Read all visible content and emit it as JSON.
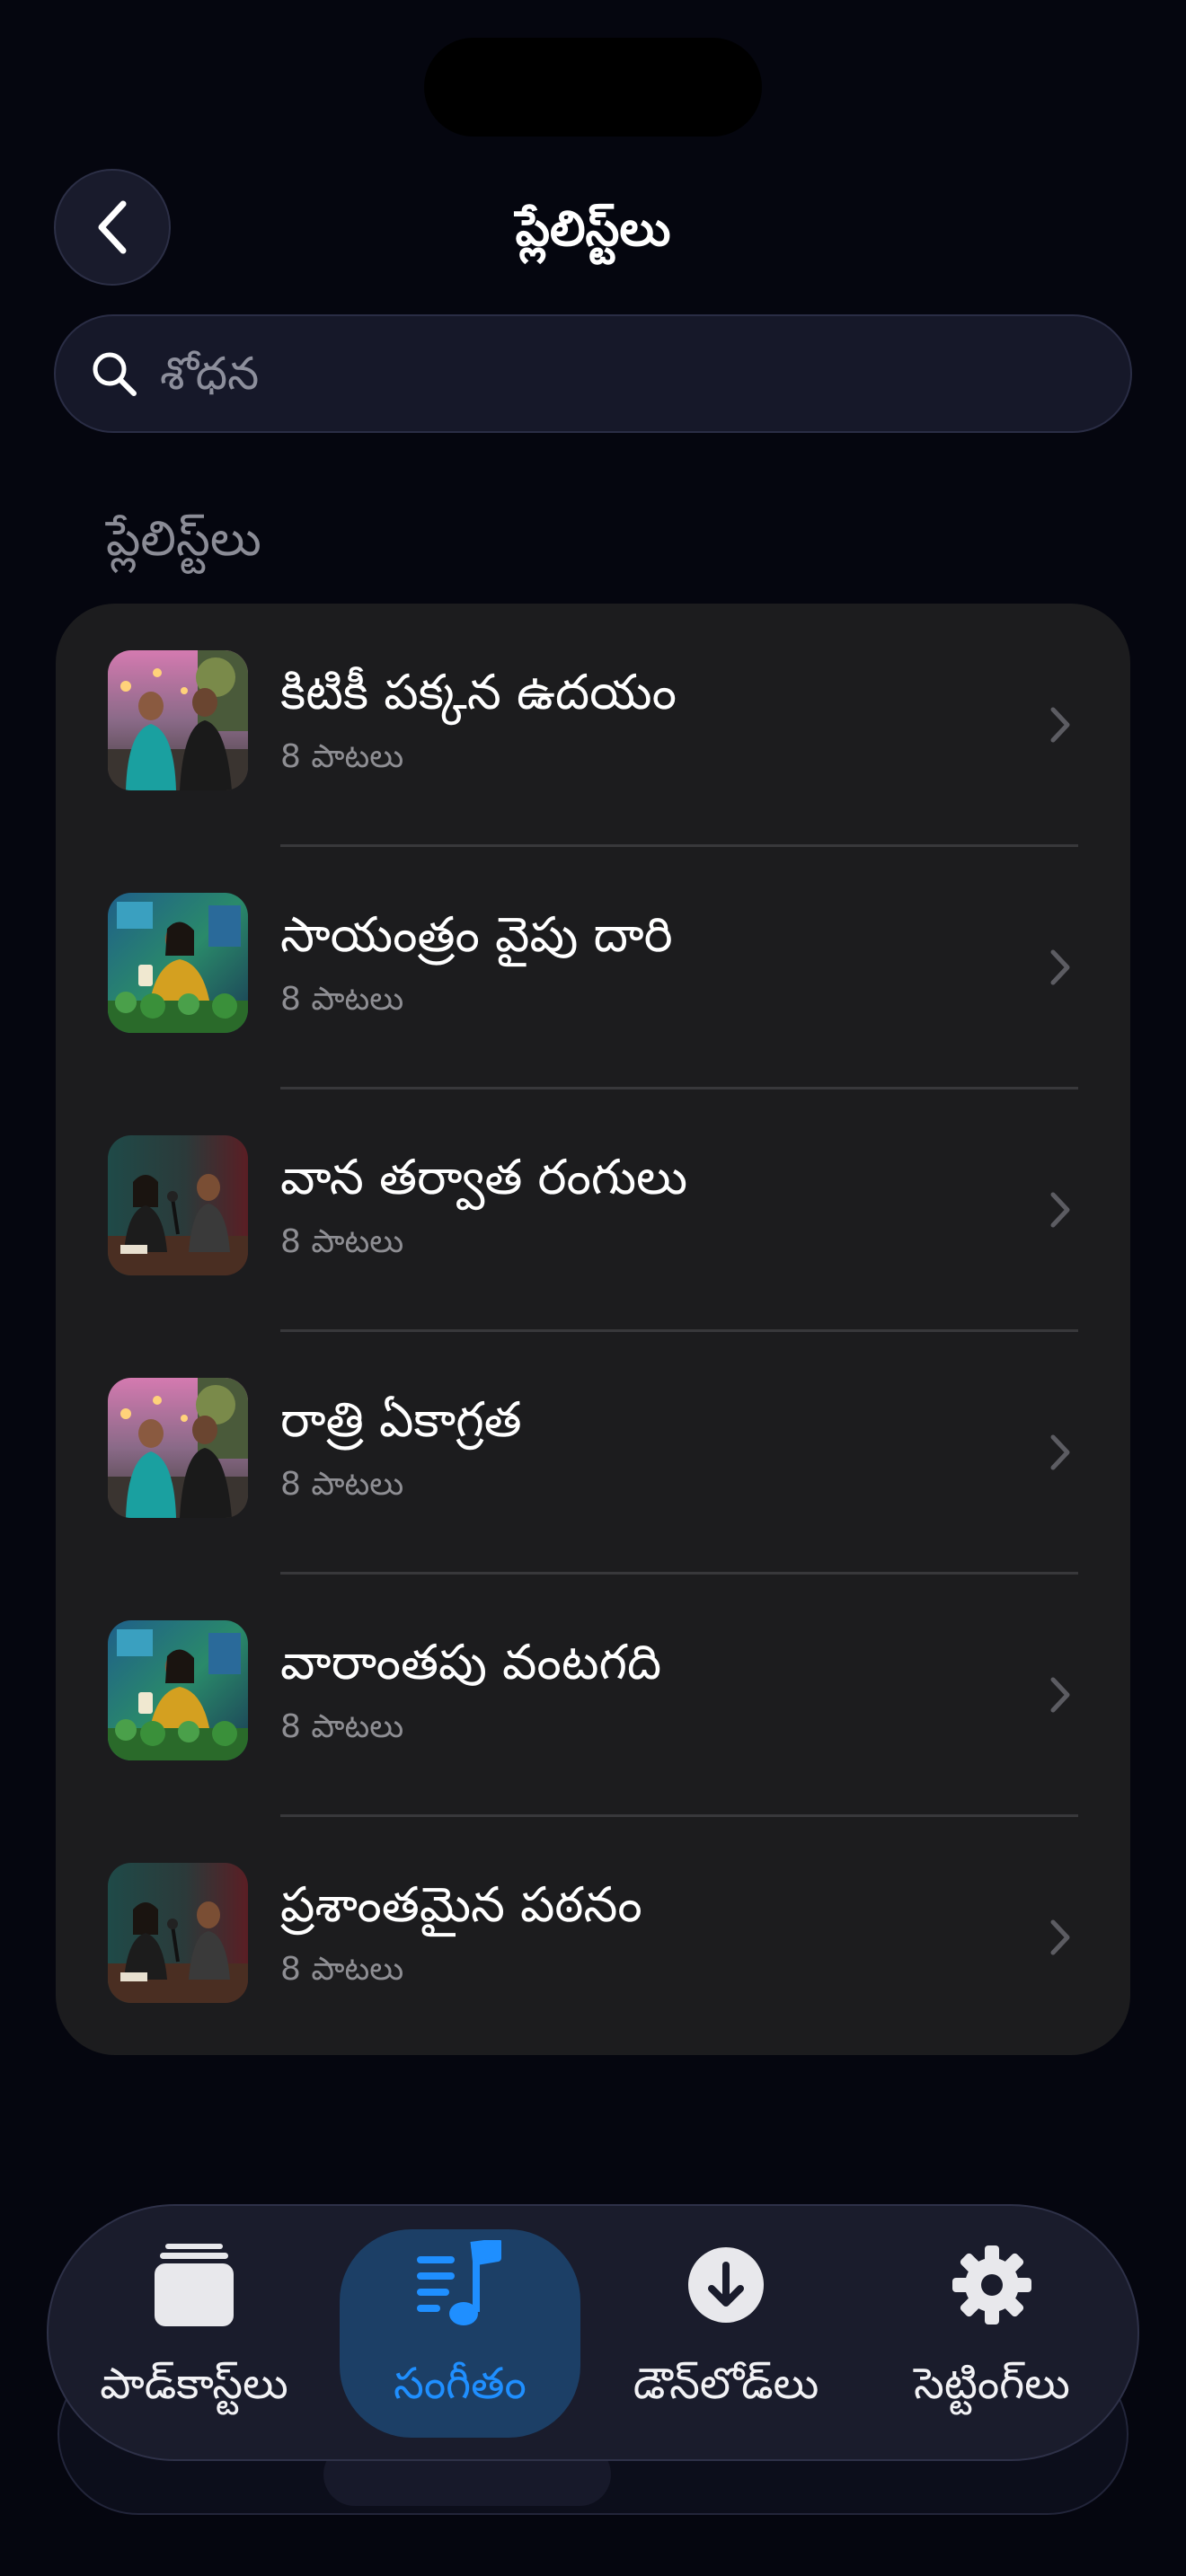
{
  "header": {
    "title": "ప్లేలిస్ట్‌లు",
    "back_icon": "chevron-left-icon"
  },
  "search": {
    "placeholder": "శోధన",
    "value": ""
  },
  "section": {
    "label": "ప్లేలిస్ట్‌లు"
  },
  "playlists": [
    {
      "title": "కిటికీ పక్కన ఉదయం",
      "subtitle": "8 పాటలు",
      "thumb": "street-couple"
    },
    {
      "title": "సాయంత్రం వైపు దారి",
      "subtitle": "8 పాటలు",
      "thumb": "woman-plants"
    },
    {
      "title": "వాన తర్వాత రంగులు",
      "subtitle": "8 పాటలు",
      "thumb": "podcast-studio"
    },
    {
      "title": "రాత్రి ఏకాగ్రత",
      "subtitle": "8 పాటలు",
      "thumb": "street-couple"
    },
    {
      "title": "వారాంతపు వంటగది",
      "subtitle": "8 పాటలు",
      "thumb": "woman-plants"
    },
    {
      "title": "ప్రశాంతమైన పఠనం",
      "subtitle": "8 పాటలు",
      "thumb": "podcast-studio"
    }
  ],
  "tabbar": {
    "tabs": [
      {
        "label": "పాడ్‌కాస్ట్‌లు",
        "icon": "stack-icon",
        "active": false
      },
      {
        "label": "సంగీతం",
        "icon": "music-list-icon",
        "active": true
      },
      {
        "label": "డౌన్‌లోడ్‌లు",
        "icon": "download-circle-icon",
        "active": false
      },
      {
        "label": "సెట్టింగ్‌లు",
        "icon": "gear-icon",
        "active": false
      }
    ]
  },
  "colors": {
    "background": "#05060f",
    "card": "#1c1c1e",
    "accent": "#1f8fff",
    "secondary_text": "#8e8e93"
  }
}
